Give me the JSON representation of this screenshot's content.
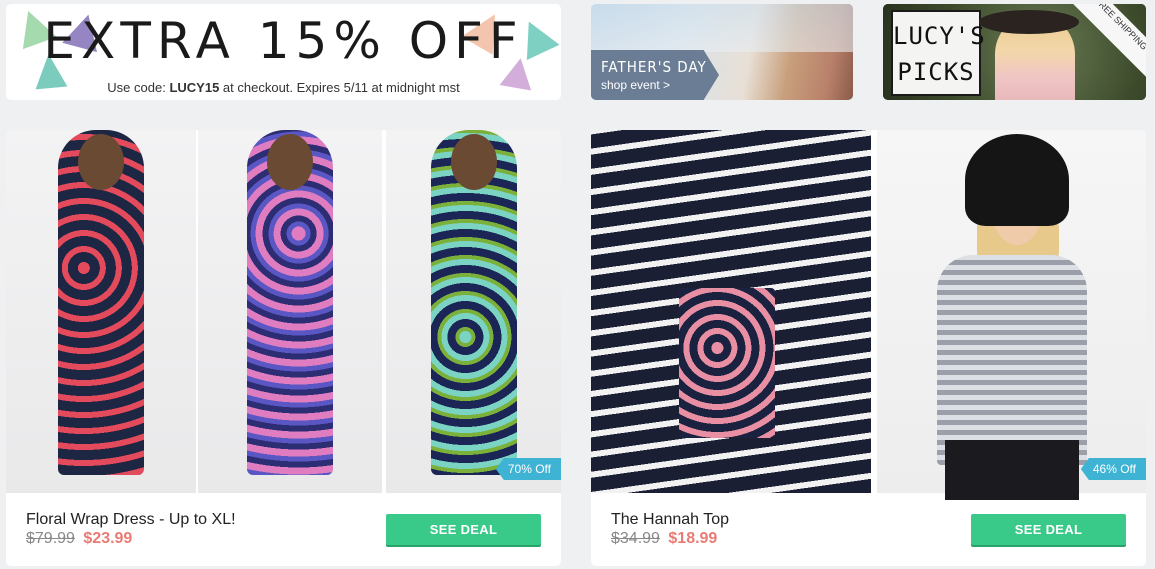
{
  "banners": {
    "promo": {
      "headline": "EXTRA 15% OFF",
      "line_before": "Use code: ",
      "code": "LUCY15",
      "line_after": " at checkout. Expires 5/11 at midnight mst"
    },
    "fathers_day": {
      "title": "FATHER'S DAY",
      "link": "shop event >"
    },
    "lucys_picks": {
      "line1": "LUCY'S",
      "line2": "PICKS",
      "ribbon": "FREE SHIPPING"
    }
  },
  "deals": [
    {
      "name": "Floral Wrap Dress - Up to XL!",
      "old_price": "$79.99",
      "new_price": "$23.99",
      "discount": "70% Off",
      "button": "SEE DEAL"
    },
    {
      "name": "The Hannah Top",
      "old_price": "$34.99",
      "new_price": "$18.99",
      "discount": "46% Off",
      "button": "SEE DEAL"
    }
  ],
  "colors": {
    "background": "#eef0f1",
    "button_green": "#39c989",
    "badge_blue": "#3fb3d3",
    "sale_price": "#e97b74"
  }
}
